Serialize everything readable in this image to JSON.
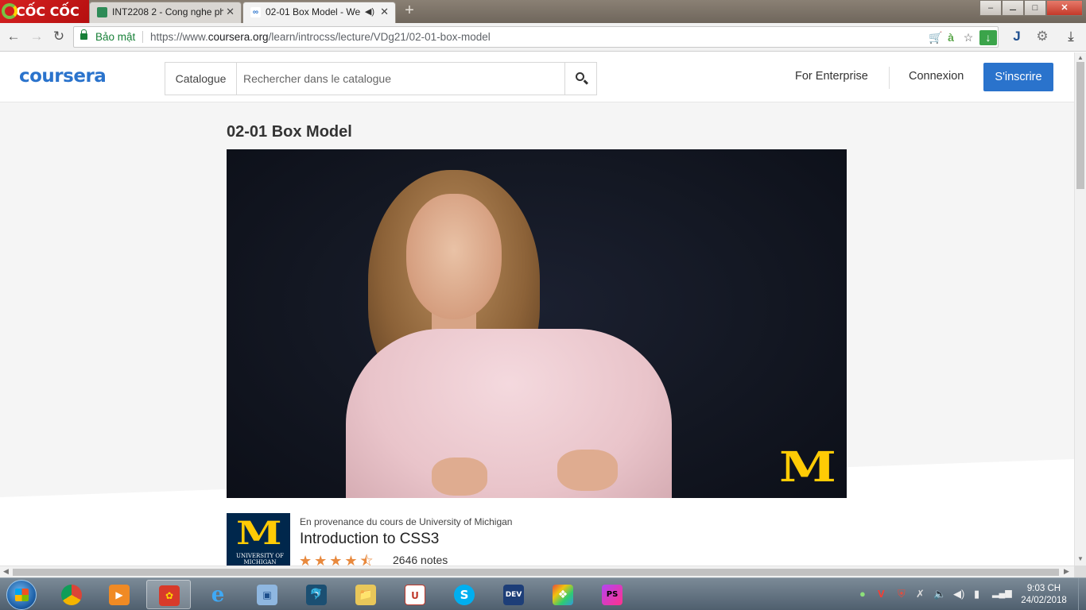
{
  "browser": {
    "brand": "CỐC CỐC",
    "tabs": [
      {
        "title": "INT2208 2 - Cong nghe ph",
        "active": false
      },
      {
        "title": "02-01 Box Model - We",
        "active": true
      }
    ],
    "window_controls": {
      "minimize": "–",
      "maximize": "□",
      "close": "✕"
    },
    "secure_label": "Bảo mật",
    "url_prefix": "https://www.",
    "url_domain": "coursera.org",
    "url_path": "/learn/introcss/lecture/VDg21/02-01-box-model"
  },
  "site": {
    "logo": "coursera",
    "search": {
      "catalogue_label": "Catalogue",
      "placeholder": "Rechercher dans le catalogue"
    },
    "nav": {
      "enterprise": "For Enterprise",
      "login": "Connexion",
      "signup": "S'inscrire"
    },
    "accent_color": "#2a73cc"
  },
  "lecture": {
    "title": "02-01 Box Model",
    "video_watermark": "M"
  },
  "course": {
    "partner_logo_text": "UNIVERSITY OF MICHIGAN",
    "provenance": "En provenance du cours de University of Michigan",
    "title": "Introduction to CSS3",
    "rating": 4.5,
    "stars": "★★★★⯪",
    "ratings_count": "2646 notes"
  },
  "taskbar": {
    "apps": [
      {
        "name": "chrome",
        "label": ""
      },
      {
        "name": "media-player",
        "label": "▶"
      },
      {
        "name": "coccoc",
        "label": "✿",
        "active": true
      },
      {
        "name": "internet-explorer",
        "label": "e"
      },
      {
        "name": "virtualbox",
        "label": "▣"
      },
      {
        "name": "mysql-workbench",
        "label": "🐬"
      },
      {
        "name": "file-explorer",
        "label": "📁"
      },
      {
        "name": "unikey",
        "label": "U"
      },
      {
        "name": "skype",
        "label": "S"
      },
      {
        "name": "dev-cpp",
        "label": "DEV"
      },
      {
        "name": "colorful-app",
        "label": "❖"
      },
      {
        "name": "phpstorm",
        "label": "PS"
      }
    ],
    "clock_time": "9:03 CH",
    "clock_date": "24/02/2018"
  }
}
